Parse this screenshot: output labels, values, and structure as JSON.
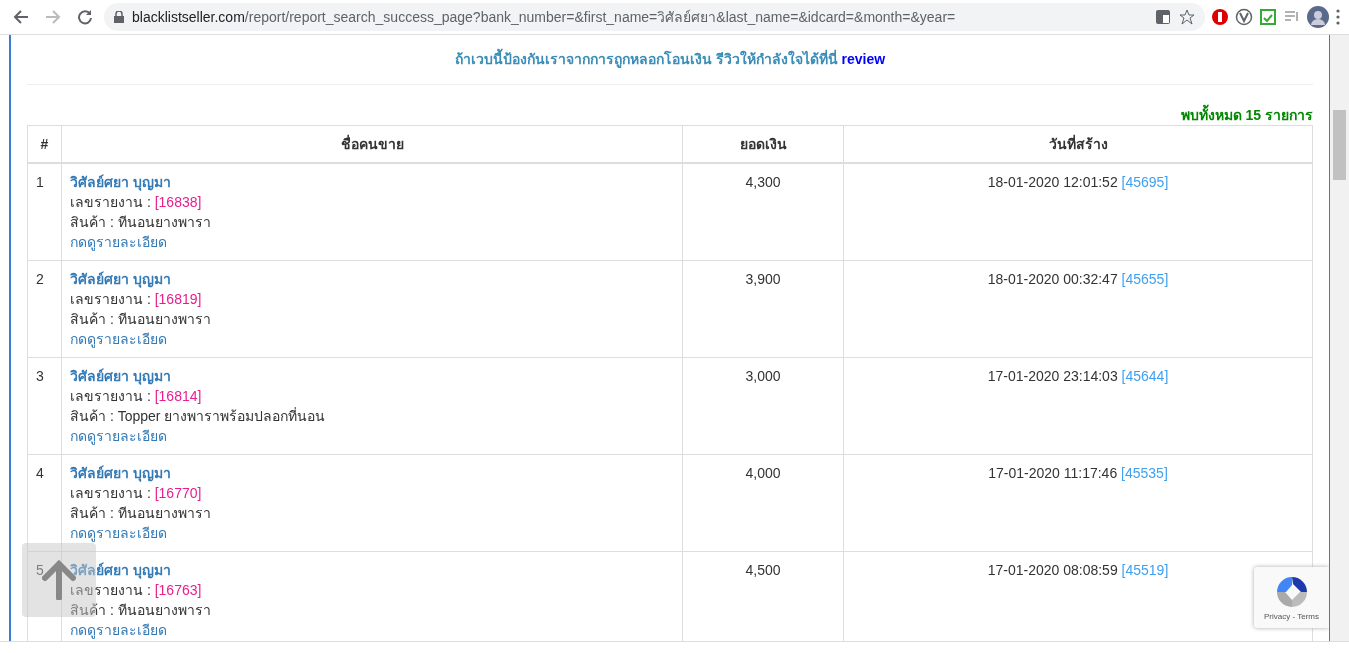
{
  "browser": {
    "url_host": "blacklistseller.com",
    "url_path": "/report/report_search_success_page?bank_number=&first_name=วิศัลย์ศยา&last_name=&idcard=&month=&year="
  },
  "notice": {
    "text": "ถ้าเวบนี้ป้องกันเราจากการถูกหลอกโอนเงิน รีวิวให้กำลังใจได้ที่นี่",
    "link": "review"
  },
  "result_count": "พบทั้งหมด 15 รายการ",
  "table": {
    "columns": [
      "#",
      "ชื่อคนขาย",
      "ยอดเงิน",
      "วันที่สร้าง"
    ],
    "rows": [
      {
        "number": "1",
        "seller": "วิศัลย์ศยา บุญมา",
        "report_label": "เลขรายงาน :",
        "report_id": "[16838]",
        "product": "สินค้า : ทีนอนยางพารา",
        "detail_link": "กดดูรายละเอียด",
        "amount": "4,300",
        "created": "18-01-2020 12:01:52",
        "created_id": "[45695]"
      },
      {
        "number": "2",
        "seller": "วิศัลย์ศยา บุญมา",
        "report_label": "เลขรายงาน :",
        "report_id": "[16819]",
        "product": "สินค้า : ทีนอนยางพารา",
        "detail_link": "กดดูรายละเอียด",
        "amount": "3,900",
        "created": "18-01-2020 00:32:47",
        "created_id": "[45655]"
      },
      {
        "number": "3",
        "seller": "วิศัลย์ศยา บุญมา",
        "report_label": "เลขรายงาน :",
        "report_id": "[16814]",
        "product": "สินค้า : Topper ยางพาราพร้อมปลอกที่นอน",
        "detail_link": "กดดูรายละเอียด",
        "amount": "3,000",
        "created": "17-01-2020 23:14:03",
        "created_id": "[45644]"
      },
      {
        "number": "4",
        "seller": "วิศัลย์ศยา บุญมา",
        "report_label": "เลขรายงาน :",
        "report_id": "[16770]",
        "product": "สินค้า : ทีนอนยางพารา",
        "detail_link": "กดดูรายละเอียด",
        "amount": "4,000",
        "created": "17-01-2020 11:17:46",
        "created_id": "[45535]"
      },
      {
        "number": "5",
        "seller": "วิศัลย์ศยา บุญมา",
        "report_label": "เลขรายงาน :",
        "report_id": "[16763]",
        "product": "สินค้า : ทีนอนยางพารา",
        "detail_link": "กดดูรายละเอียด",
        "amount": "4,500",
        "created": "17-01-2020 08:08:59",
        "created_id": "[45519]"
      }
    ]
  },
  "recaptcha": {
    "links": "Privacy - Terms"
  }
}
